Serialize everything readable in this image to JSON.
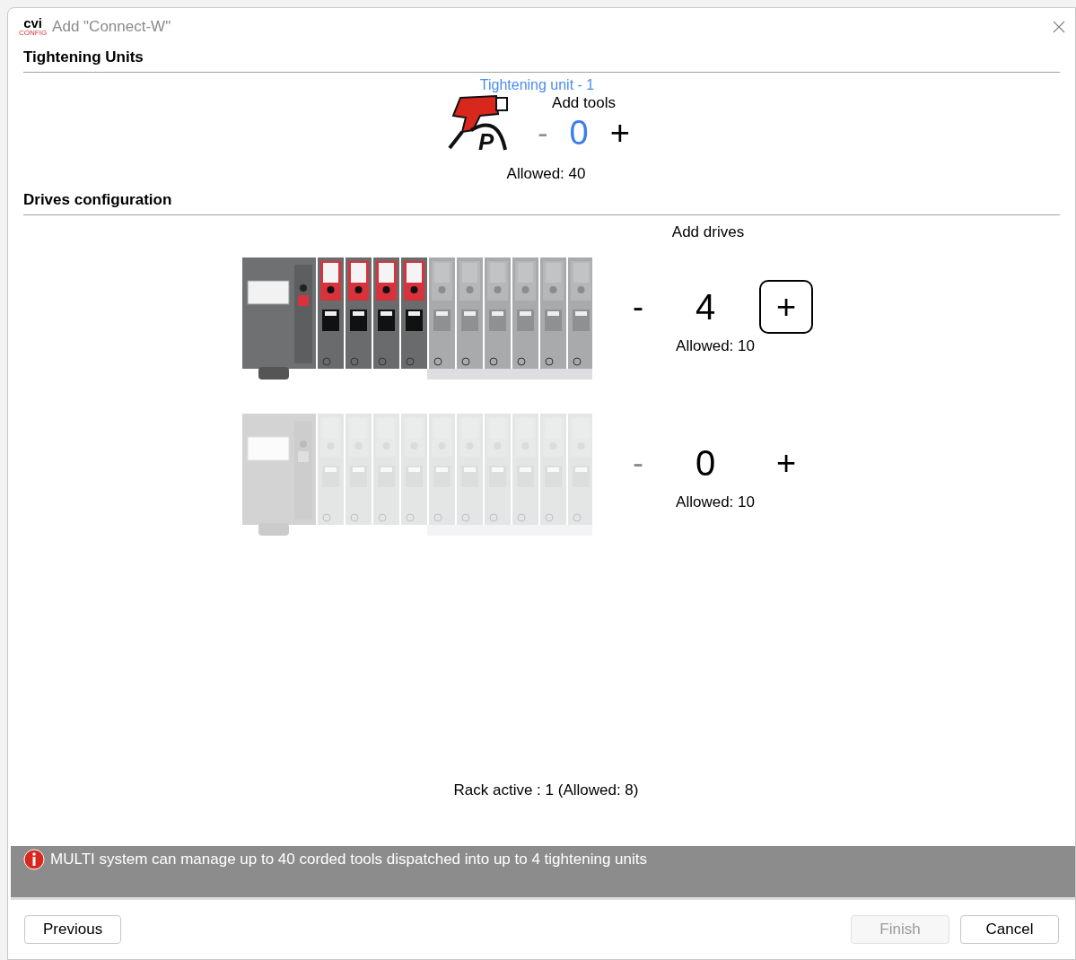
{
  "window": {
    "logo": {
      "mark": "cvi",
      "sub": "CONFIG"
    },
    "title": "Add \"Connect-W\""
  },
  "tightening": {
    "heading": "Tightening Units",
    "unit_label": "Tightening unit - 1",
    "tool_letter": "P",
    "add_label": "Add tools",
    "minus": "-",
    "minus_disabled": true,
    "count": "0",
    "plus": "+",
    "allowed": "Allowed: 40"
  },
  "drives": {
    "heading": "Drives configuration",
    "add_label": "Add drives",
    "racks": [
      {
        "enabled": true,
        "minus": "-",
        "minus_disabled": false,
        "count": "4",
        "plus": "+",
        "plus_focused": true,
        "allowed": "Allowed: 10",
        "slots": [
          {
            "filled": true
          },
          {
            "filled": true
          },
          {
            "filled": true
          },
          {
            "filled": true
          },
          {
            "filled": false
          },
          {
            "filled": false
          },
          {
            "filled": false
          },
          {
            "filled": false
          },
          {
            "filled": false
          },
          {
            "filled": false
          }
        ]
      },
      {
        "enabled": false,
        "minus": "-",
        "minus_disabled": true,
        "count": "0",
        "plus": "+",
        "plus_focused": false,
        "allowed": "Allowed: 10",
        "slots": [
          {
            "filled": false
          },
          {
            "filled": false
          },
          {
            "filled": false
          },
          {
            "filled": false
          },
          {
            "filled": false
          },
          {
            "filled": false
          },
          {
            "filled": false
          },
          {
            "filled": false
          },
          {
            "filled": false
          },
          {
            "filled": false
          }
        ]
      }
    ],
    "rack_status": "Rack active : 1 (Allowed: 8)"
  },
  "info": {
    "message": "MULTI system can manage up to 40 corded tools dispatched into up to 4 tightening units"
  },
  "footer": {
    "previous": {
      "label": "Previous",
      "disabled": false
    },
    "buttons": [
      {
        "label": "Finish",
        "disabled": true
      },
      {
        "label": "Cancel",
        "disabled": false
      }
    ]
  }
}
